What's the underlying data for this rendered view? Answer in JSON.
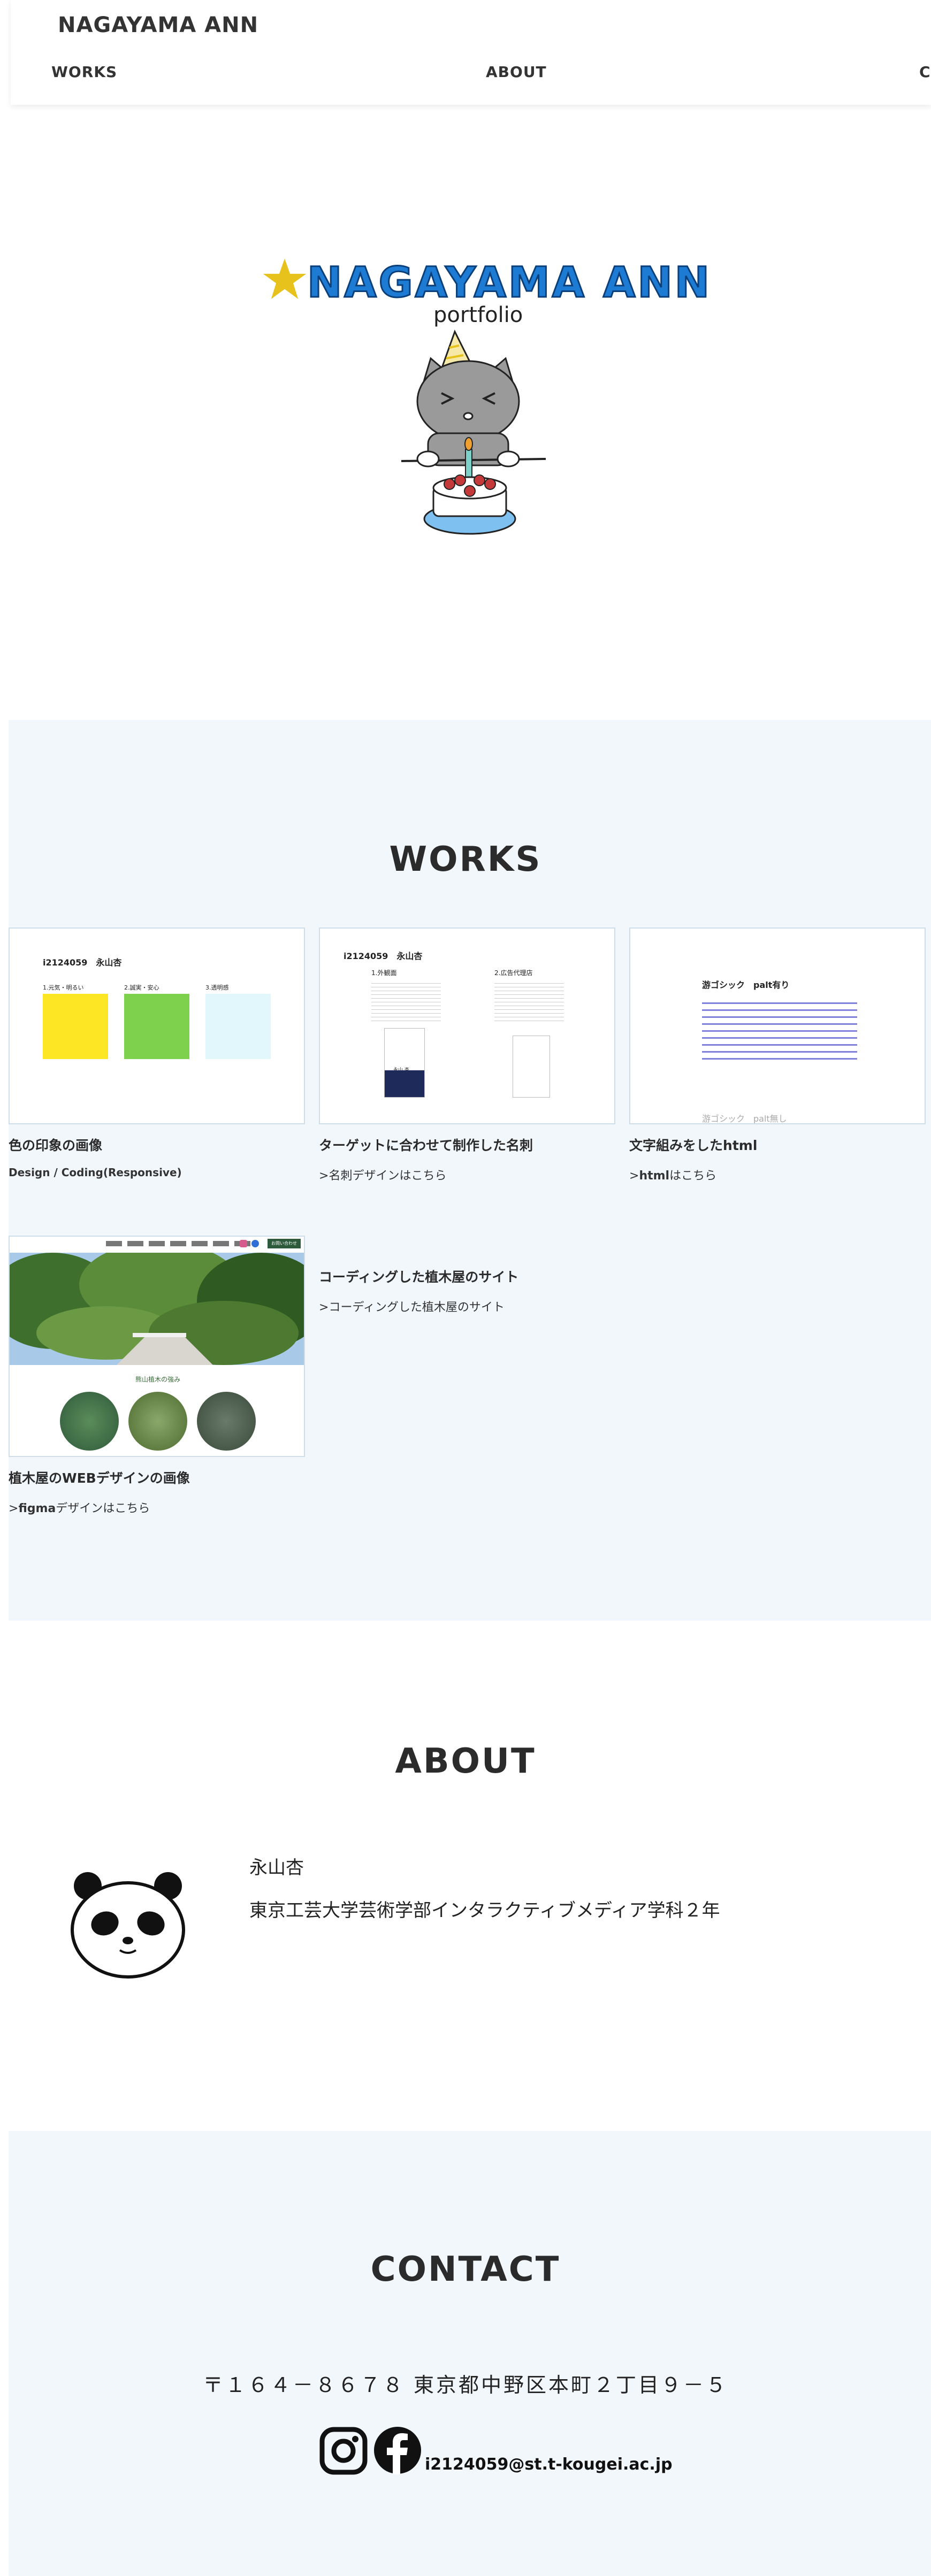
{
  "header": {
    "brand": "NAGAYAMA ANN",
    "nav": [
      {
        "label": "WORKS"
      },
      {
        "label": "ABOUT"
      },
      {
        "label": "C"
      }
    ]
  },
  "hero": {
    "title": "NAGAYAMA ANN",
    "subtitle": "portfolio",
    "star_color": "#e8c21c",
    "title_color": "#1d7bd3"
  },
  "works": {
    "title": "WORKS",
    "items": [
      {
        "title": "色の印象の画像",
        "link_label": "Design / Coding(Responsive)",
        "thumb": {
          "name": "i2124059　永山杏",
          "labels": [
            "1.元気・明るい",
            "2.誠実・安心",
            "3.透明感"
          ],
          "swatches": [
            "#fde624",
            "#7ed14d",
            "#e2f7fc"
          ]
        }
      },
      {
        "title": "ターゲットに合わせて制作した名刺",
        "link_prefix": ">",
        "link_label": "名刺デザインはこちら",
        "thumb": {
          "name": "i2124059　永山杏",
          "col1": "1.外観面",
          "col2": "2.広告代理店",
          "card_name": "永山 杏"
        }
      },
      {
        "title_prefix": "文字組みをした",
        "title_bold": "html",
        "link_prefix": ">",
        "link_bold": "html",
        "link_label": "はこちら",
        "thumb": {
          "heading": "游ゴシック　palt有り",
          "footer": "游ゴシック　palt無し"
        }
      },
      {
        "title": "植木屋のWEBデザインの画像",
        "link_prefix": ">",
        "link_bold": "figma",
        "link_label": "デザインはこちら",
        "thumb": {
          "section_label": "熊山植木の強み",
          "btn_label": "お問い合わせ"
        }
      },
      {
        "title": "コーディングした植木屋のサイト",
        "link_prefix": ">",
        "link_label": "コーディングした植木屋のサイト"
      }
    ]
  },
  "about": {
    "title": "ABOUT",
    "name": "永山杏",
    "affiliation": "東京工芸大学芸術学部インタラクティブメディア学科２年"
  },
  "contact": {
    "title": "CONTACT",
    "address": "〒１６４－８６７８ 東京都中野区本町２丁目９－５",
    "email": "i2124059@st.t-kougei.ac.jp"
  }
}
